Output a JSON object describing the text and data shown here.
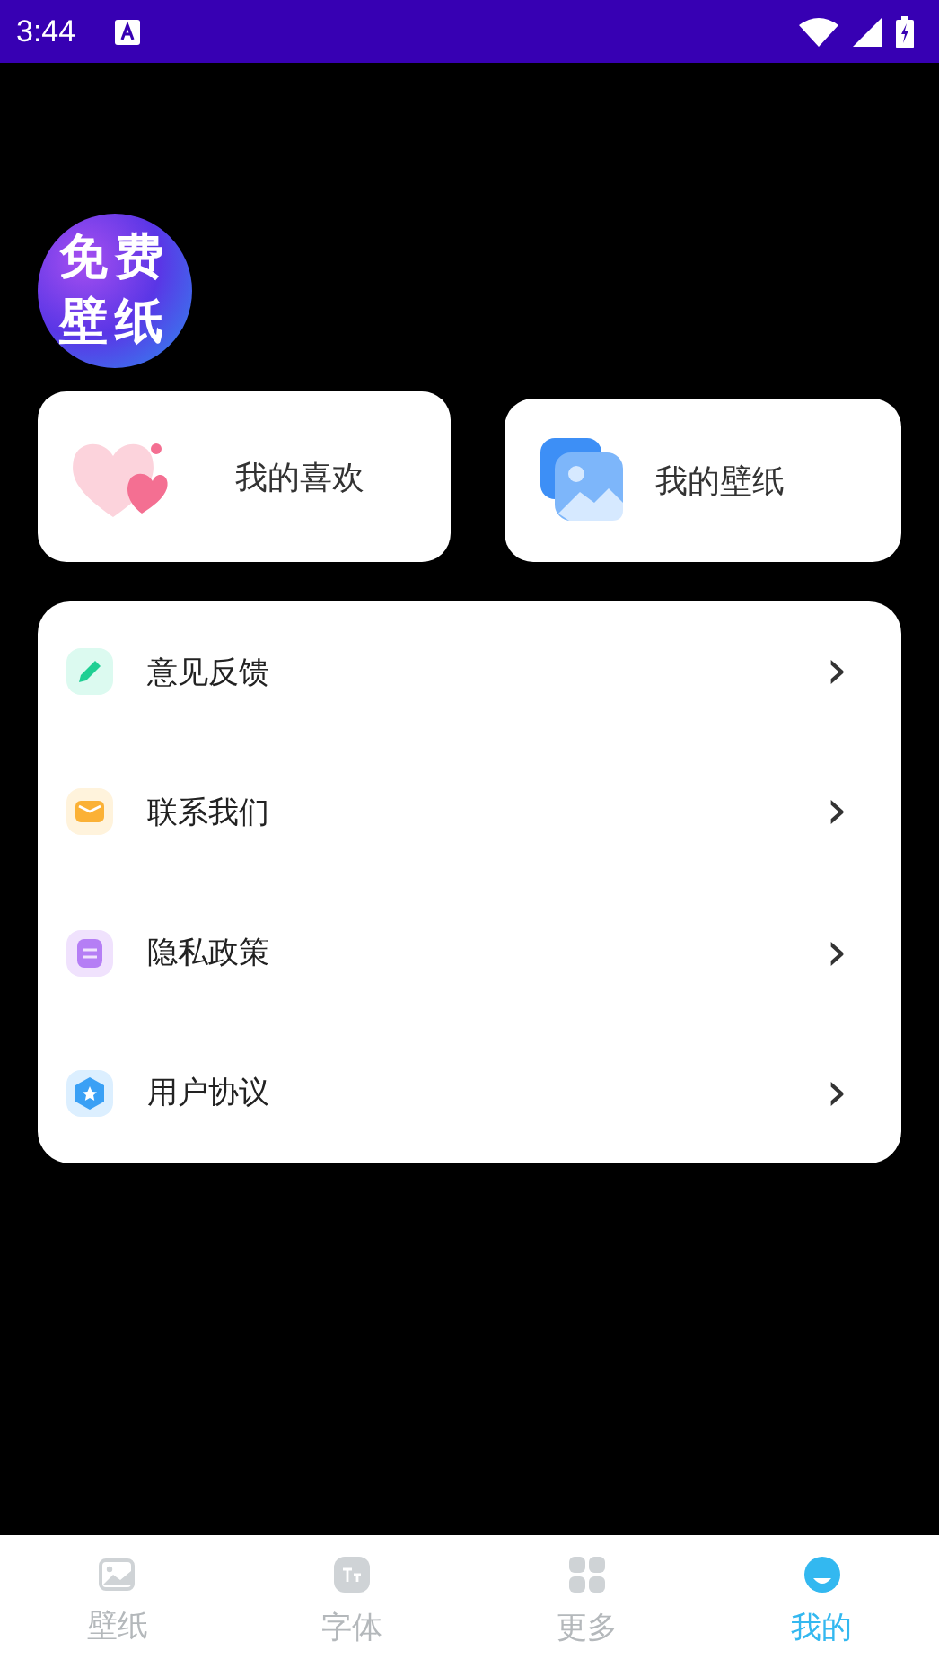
{
  "status_bar": {
    "time": "3:44"
  },
  "logo": {
    "lines": [
      "免费",
      "壁纸"
    ]
  },
  "shortcuts": [
    {
      "kind": "heart",
      "label": "我的喜欢"
    },
    {
      "kind": "image",
      "label": "我的壁纸"
    }
  ],
  "menu": [
    {
      "kind": "pencil",
      "label": "意见反馈",
      "chevron": "›"
    },
    {
      "kind": "mail",
      "label": "联系我们",
      "chevron": "›"
    },
    {
      "kind": "document",
      "label": "隐私政策",
      "chevron": "›"
    },
    {
      "kind": "shield",
      "label": "用户协议",
      "chevron": "›"
    }
  ],
  "tabs": [
    {
      "kind": "image",
      "label": "壁纸",
      "selected": false
    },
    {
      "kind": "font",
      "label": "字体",
      "selected": false
    },
    {
      "kind": "grid",
      "label": "更多",
      "selected": false
    },
    {
      "kind": "face",
      "label": "我的",
      "selected": true
    }
  ]
}
